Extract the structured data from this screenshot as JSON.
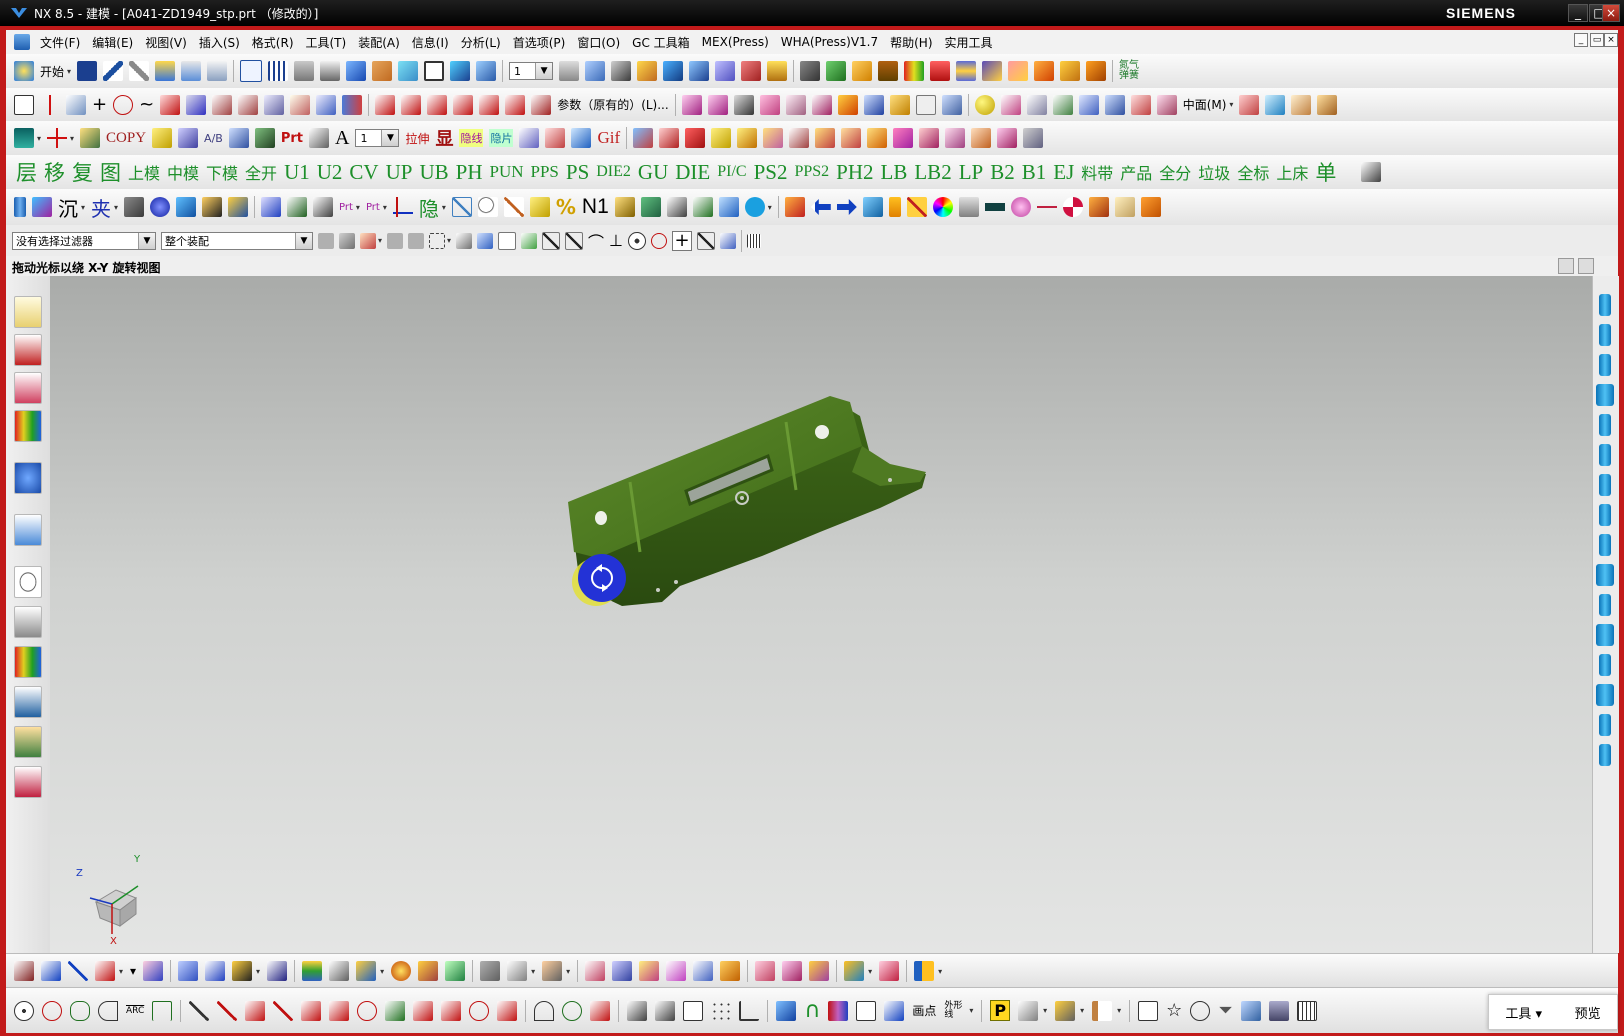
{
  "window": {
    "title": "NX 8.5 - 建模 - [A041-ZD1949_stp.prt （修改的）]",
    "brand": "SIEMENS",
    "controls": [
      "_",
      "□",
      "×"
    ]
  },
  "menubar": {
    "items": [
      "文件(F)",
      "编辑(E)",
      "视图(V)",
      "插入(S)",
      "格式(R)",
      "工具(T)",
      "装配(A)",
      "信息(I)",
      "分析(L)",
      "首选项(P)",
      "窗口(O)",
      "GC 工具箱",
      "MEX(Press)",
      "WHA(Press)V1.7",
      "帮助(H)",
      "实用工具"
    ]
  },
  "toolbar1": {
    "start_label": "开始",
    "layer_value": "1",
    "right_label": "氮气弹簧"
  },
  "toolbar2": {
    "param_label": "参数（原有的）(L)...",
    "mid_label": "中面(M)"
  },
  "toolbar3": {
    "copy_label": "COPY",
    "ab_label": "A/B",
    "prt_label": "Prt",
    "text_label": "A",
    "width_value": "1",
    "stretch_label": "拉伸",
    "show_label": "显",
    "hide_line_label": "隐线",
    "hide_piece_label": "隐片",
    "gif_label": "Gif"
  },
  "command_bar": {
    "items": [
      "层",
      "移",
      "复",
      "图",
      "上模",
      "中模",
      "下模",
      "全开",
      "U1",
      "U2",
      "CV",
      "UP",
      "UB",
      "PH",
      "PUN",
      "PPS",
      "PS",
      "DIE2",
      "GU",
      "DIE",
      "PI/C",
      "PS2",
      "PPS2",
      "PH2",
      "LB",
      "LB2",
      "LP",
      "B2",
      "B1",
      "EJ",
      "料带",
      "产品",
      "全分",
      "垃圾",
      "全标",
      "上床",
      "单"
    ]
  },
  "toolbar5": {
    "sink_label": "沉",
    "clip_label": "夹",
    "prt_in": "Prt",
    "prt_out": "Prt",
    "hide_label": "隐",
    "n1_label": "N1"
  },
  "selection_bar": {
    "filter_value": "没有选择过滤器",
    "scope_value": "整个装配"
  },
  "prompt": {
    "text": "拖动光标以绕 X-Y 旋转视图"
  },
  "triad": {
    "z": "Z",
    "y": "Y",
    "x": "X"
  },
  "bottom_toolbar": {
    "arc_label": "ARC",
    "point_label": "画点",
    "outer_label": "外形线",
    "p_label": "P"
  },
  "popup": {
    "tools_label": "工具",
    "preview_label": "预览"
  },
  "colors": {
    "part_green": "#4f7a22",
    "title_bg": "#000000",
    "frame_red": "#c21a1a",
    "command_green": "#1d8f2a",
    "rotate_blue": "#2332d6",
    "rotate_yellow": "#e3e03a"
  }
}
